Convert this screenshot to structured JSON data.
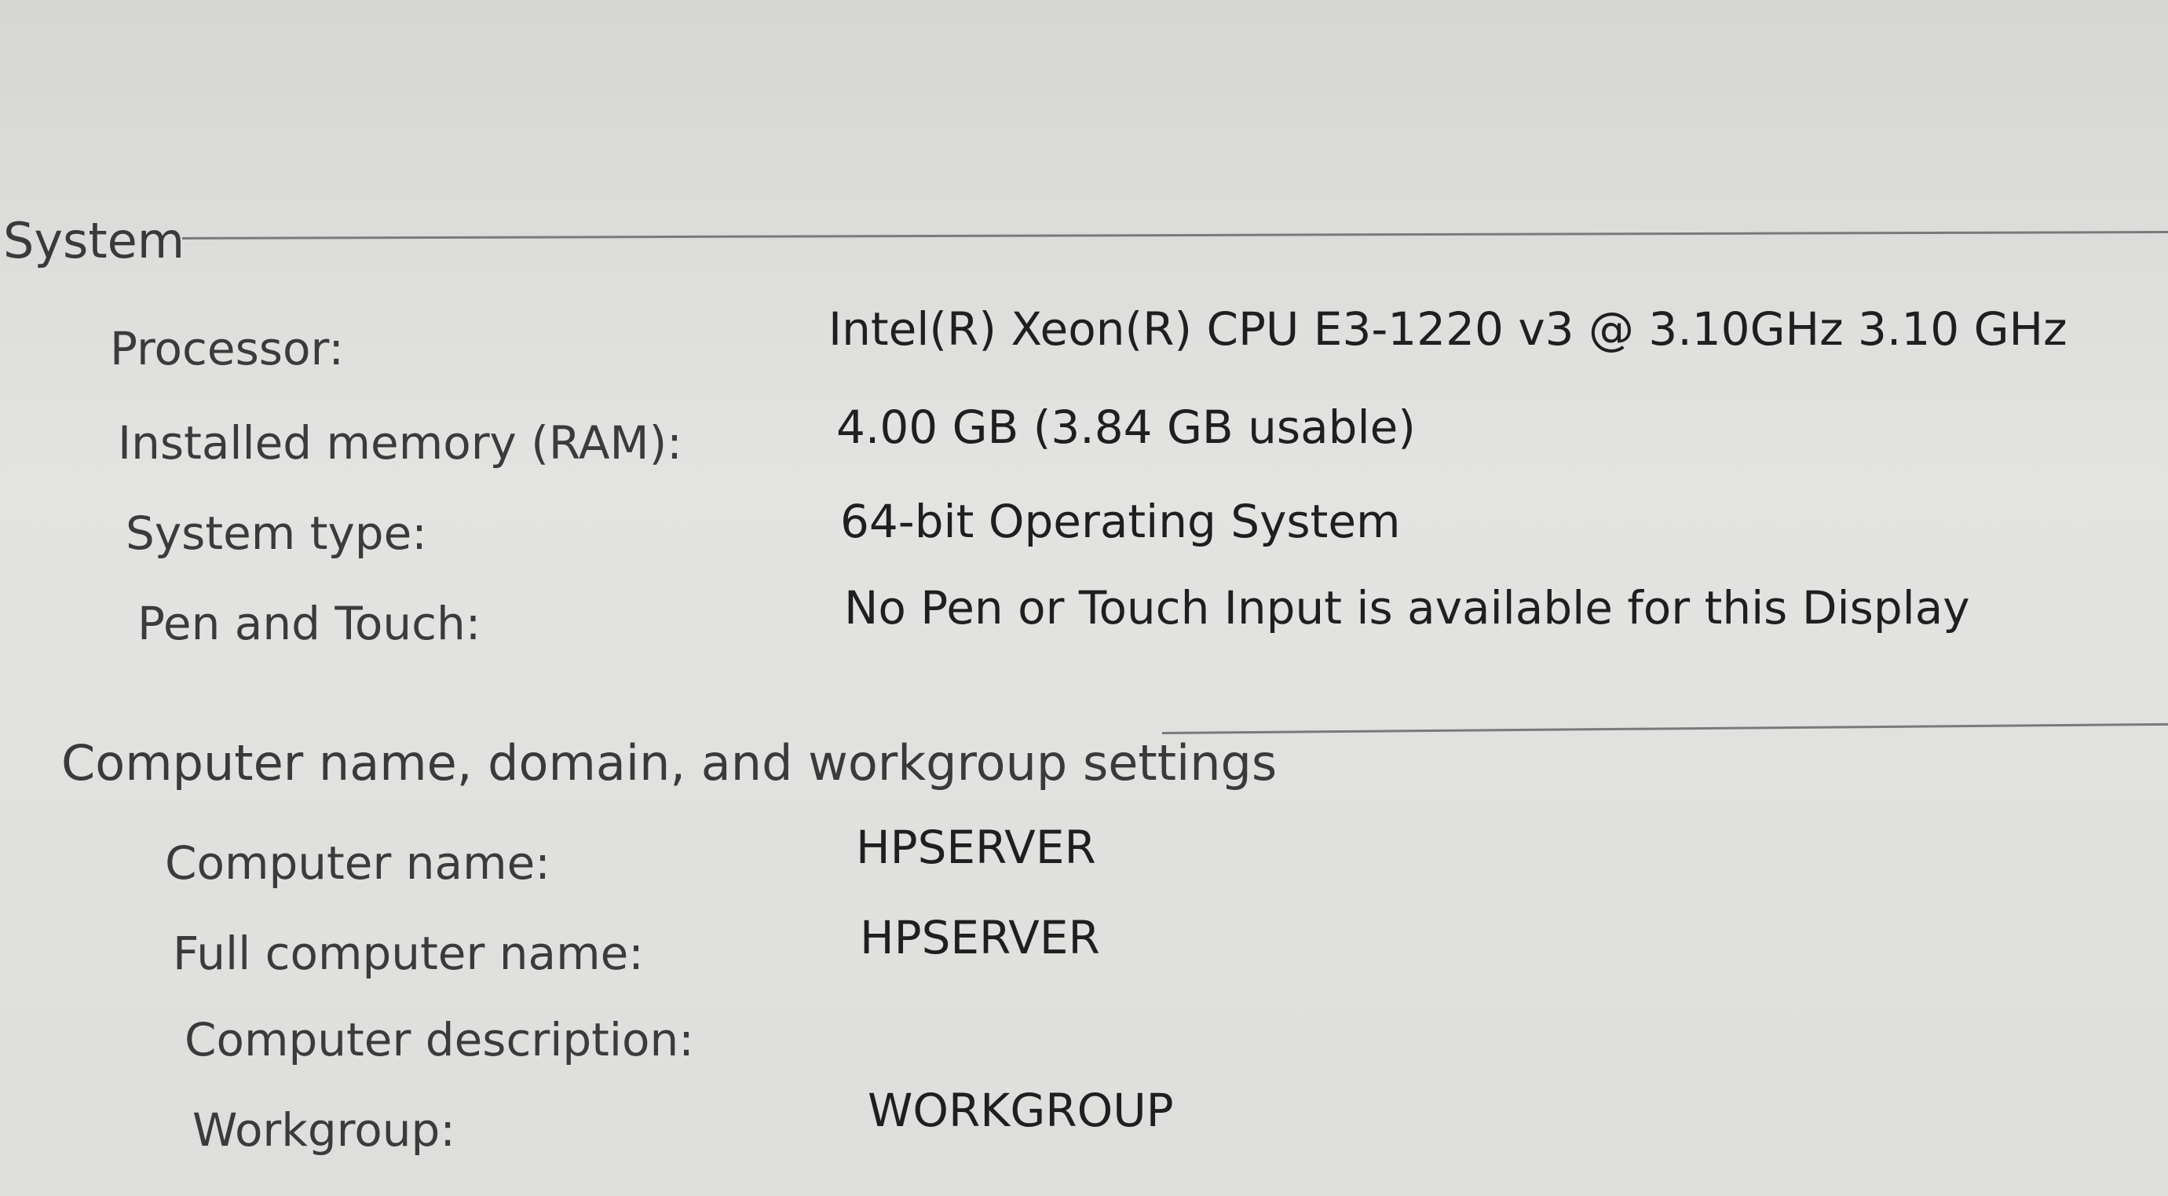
{
  "system": {
    "title": "System",
    "rows": [
      {
        "label": "Processor:",
        "value": "Intel(R) Xeon(R) CPU E3-1220 v3 @ 3.10GHz   3.10 GHz"
      },
      {
        "label": "Installed memory (RAM):",
        "value": "4.00 GB (3.84 GB usable)"
      },
      {
        "label": "System type:",
        "value": "64-bit Operating System"
      },
      {
        "label": "Pen and Touch:",
        "value": "No Pen or Touch Input is available for this Display"
      }
    ]
  },
  "computer": {
    "title": "Computer name, domain, and workgroup settings",
    "rows": [
      {
        "label": "Computer name:",
        "value": "HPSERVER"
      },
      {
        "label": "Full computer name:",
        "value": "HPSERVER"
      },
      {
        "label": "Computer description:",
        "value": ""
      },
      {
        "label": "Workgroup:",
        "value": "WORKGROUP"
      }
    ]
  }
}
